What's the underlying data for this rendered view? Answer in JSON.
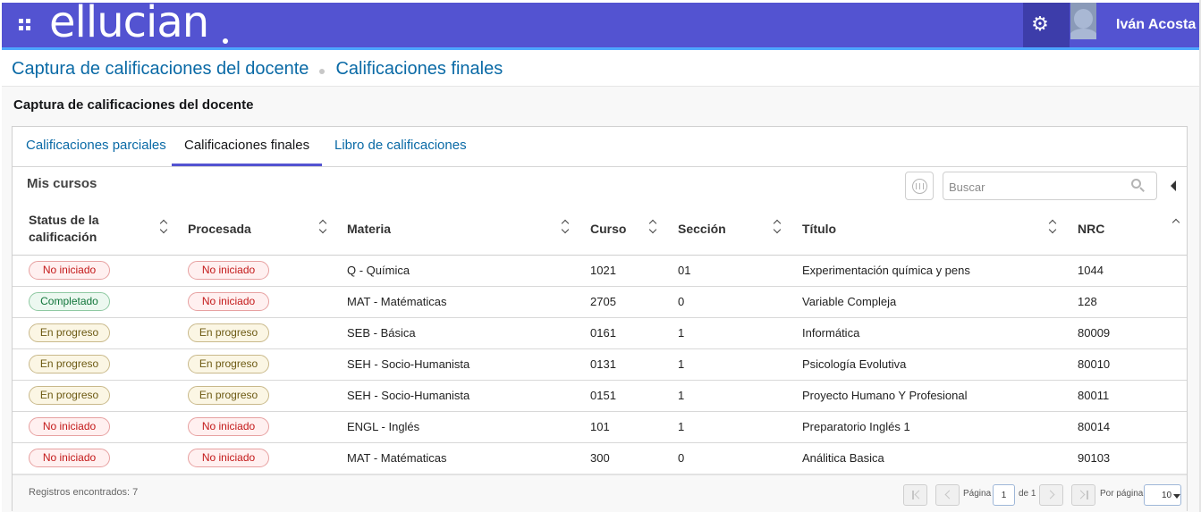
{
  "header": {
    "logo_text": "ellucian",
    "user_name": "Iván Acosta",
    "brand_color": "#5353d1",
    "accent_color": "#4da6ff",
    "icons": [
      "apps-grid-icon",
      "gear-icon",
      "user-avatar-icon"
    ]
  },
  "breadcrumb": {
    "items": [
      "Captura de calificaciones del docente",
      "Calificaciones finales"
    ]
  },
  "page": {
    "title": "Captura de calificaciones del docente"
  },
  "tabs": [
    {
      "label": "Calificaciones parciales",
      "active": false
    },
    {
      "label": "Calificaciones finales",
      "active": true
    },
    {
      "label": "Libro de calificaciones",
      "active": false
    }
  ],
  "courses": {
    "title": "Mis cursos",
    "search_placeholder": "Buscar",
    "columns": {
      "status": "Status de la calificación",
      "processed": "Procesada",
      "subject": "Materia",
      "course": "Curso",
      "section": "Sección",
      "title": "Título",
      "crn": "NRC"
    },
    "rows": [
      {
        "status": "No iniciado",
        "processed": "No iniciado",
        "subject": "Q - Química",
        "course": "1021",
        "section": "01",
        "title": "Experimentación química y pens",
        "crn": "1044"
      },
      {
        "status": "Completado",
        "processed": "No iniciado",
        "subject": "MAT - Matématicas",
        "course": "2705",
        "section": "0",
        "title": "Variable Compleja",
        "crn": "128"
      },
      {
        "status": "En progreso",
        "processed": "En progreso",
        "subject": "SEB - Básica",
        "course": "0161",
        "section": "1",
        "title": "Informática",
        "crn": "80009"
      },
      {
        "status": "En progreso",
        "processed": "En progreso",
        "subject": "SEH - Socio-Humanista",
        "course": "0131",
        "section": "1",
        "title": "Psicología Evolutiva",
        "crn": "80010"
      },
      {
        "status": "En progreso",
        "processed": "En progreso",
        "subject": "SEH - Socio-Humanista",
        "course": "0151",
        "section": "1",
        "title": "Proyecto Humano Y Profesional",
        "crn": "80011"
      },
      {
        "status": "No iniciado",
        "processed": "No iniciado",
        "subject": "ENGL - Inglés",
        "course": "101",
        "section": "1",
        "title": "Preparatorio Inglés 1",
        "crn": "80014"
      },
      {
        "status": "No iniciado",
        "processed": "No iniciado",
        "subject": "MAT - Matématicas",
        "course": "300",
        "section": "0",
        "title": "Análitica Basica",
        "crn": "90103"
      }
    ],
    "status_colors": {
      "No iniciado": "#c31919",
      "Completado": "#11753a",
      "En progreso": "#6d5a13"
    }
  },
  "footer": {
    "records_text": "Registros encontrados: 7",
    "page_label": "Página",
    "current_page": "1",
    "of_label": "de 1",
    "per_page_label": "Por página",
    "per_page_value": "10"
  }
}
